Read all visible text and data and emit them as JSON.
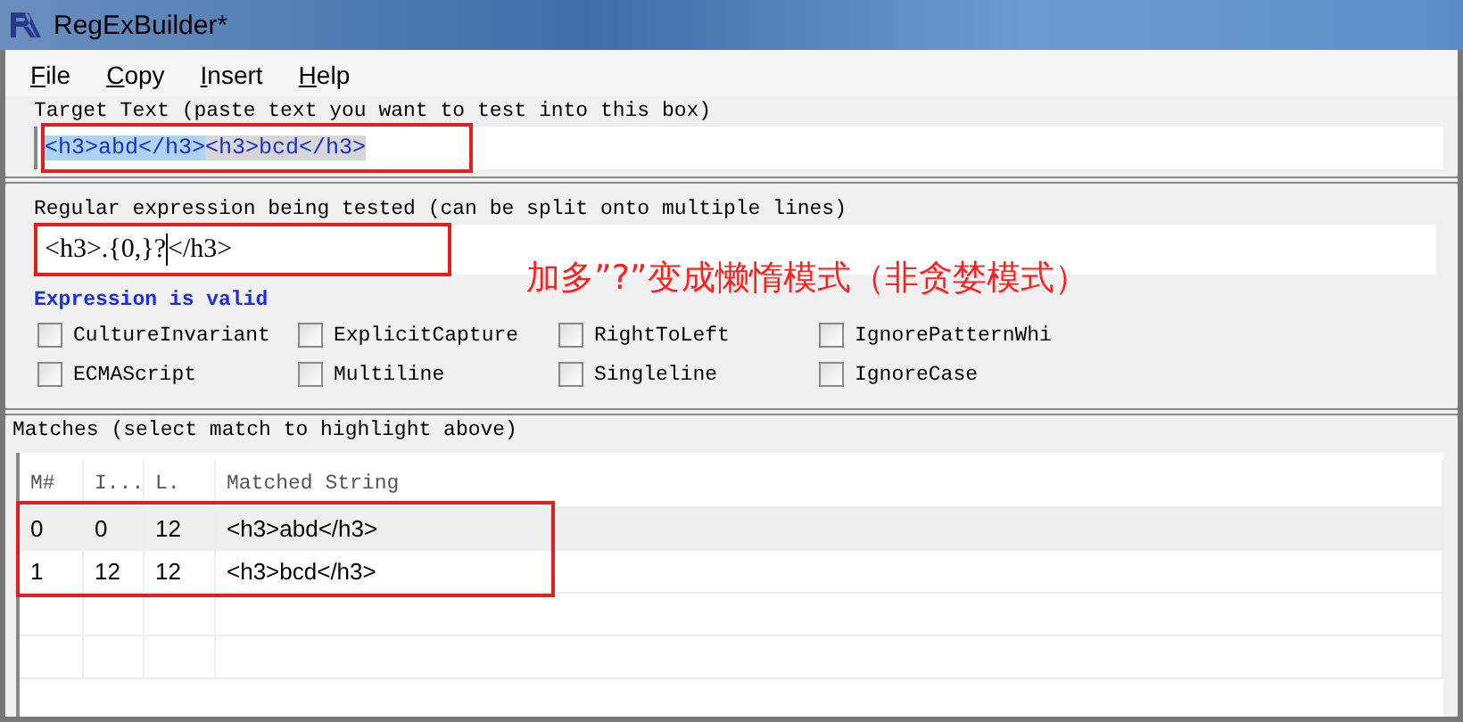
{
  "window": {
    "title": "RegExBuilder*"
  },
  "menu": [
    {
      "label": "File"
    },
    {
      "label": "Copy"
    },
    {
      "label": "Insert"
    },
    {
      "label": "Help"
    }
  ],
  "target": {
    "label": "Target Text (paste text you want to test into this box)",
    "segments": [
      {
        "text": "<h3>abd</h3>",
        "selected": true
      },
      {
        "text": "<h3>bcd</h3>",
        "selected": false
      }
    ]
  },
  "regex": {
    "label": "Regular expression being tested (can be split onto multiple lines)",
    "before_cursor": "<h3>.{0,}?",
    "after_cursor": "</h3>",
    "status": "Expression is valid"
  },
  "annotation": "加多”?”变成懒惰模式（非贪婪模式）",
  "options": [
    {
      "label": "CultureInvariant",
      "checked": false
    },
    {
      "label": "ExplicitCapture",
      "checked": false
    },
    {
      "label": "RightToLeft",
      "checked": false
    },
    {
      "label": "IgnorePatternWhi",
      "checked": false
    },
    {
      "label": "ECMAScript",
      "checked": false
    },
    {
      "label": "Multiline",
      "checked": false
    },
    {
      "label": "Singleline",
      "checked": false
    },
    {
      "label": "IgnoreCase",
      "checked": false
    }
  ],
  "matches": {
    "label": "Matches (select match to highlight above)",
    "columns": [
      "M#",
      "I...",
      "L.",
      "Matched String"
    ],
    "rows": [
      {
        "cells": [
          "0",
          "0",
          "12",
          "<h3>abd</h3>"
        ],
        "selected": true
      },
      {
        "cells": [
          "1",
          "12",
          "12",
          "<h3>bcd</h3>"
        ],
        "selected": false
      }
    ]
  }
}
